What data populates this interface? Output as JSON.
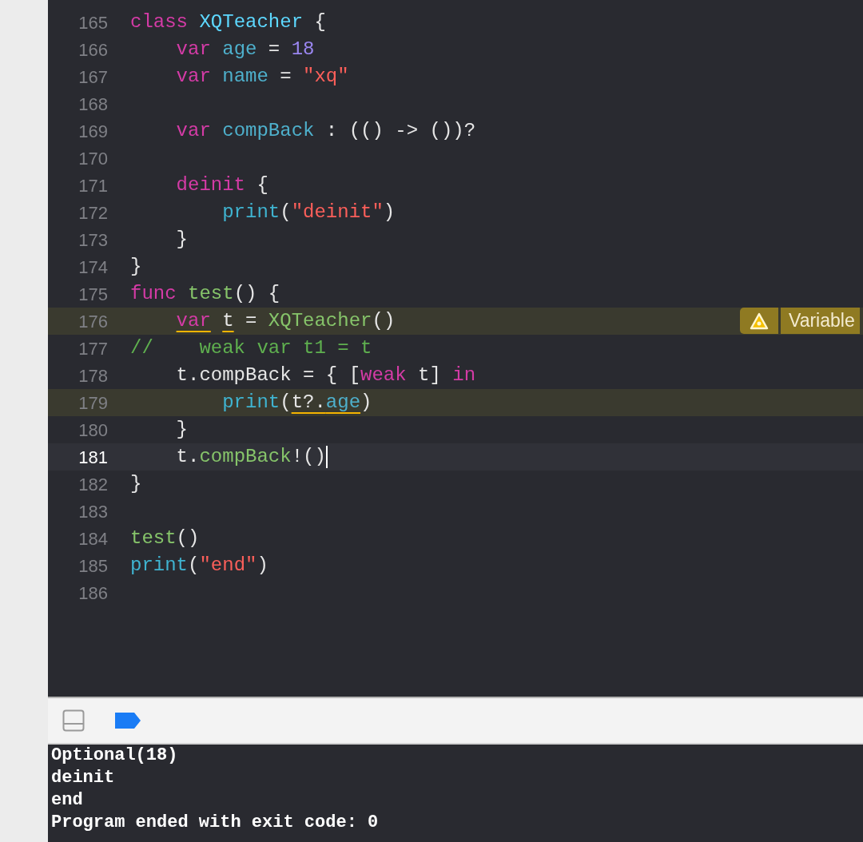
{
  "editor": {
    "lines": [
      {
        "number": "165",
        "tokens": [
          {
            "kind": "kw",
            "text": "class"
          },
          {
            "kind": "type",
            "text": " XQTeacher"
          },
          {
            "kind": "plain",
            "text": " {"
          }
        ]
      },
      {
        "number": "166",
        "tokens": [
          {
            "kind": "kw",
            "text": "    var"
          },
          {
            "kind": "prop",
            "text": " age"
          },
          {
            "kind": "plain",
            "text": " = "
          },
          {
            "kind": "num",
            "text": "18"
          }
        ]
      },
      {
        "number": "167",
        "tokens": [
          {
            "kind": "kw",
            "text": "    var"
          },
          {
            "kind": "prop",
            "text": " name"
          },
          {
            "kind": "plain",
            "text": " = "
          },
          {
            "kind": "str",
            "text": "\"xq\""
          }
        ]
      },
      {
        "number": "168"
      },
      {
        "number": "169",
        "tokens": [
          {
            "kind": "kw",
            "text": "    var"
          },
          {
            "kind": "prop",
            "text": " compBack"
          },
          {
            "kind": "plain",
            "text": " : (() -> ())?"
          }
        ]
      },
      {
        "number": "170"
      },
      {
        "number": "171",
        "tokens": [
          {
            "kind": "kw",
            "text": "    deinit"
          },
          {
            "kind": "plain",
            "text": " {"
          }
        ]
      },
      {
        "number": "172",
        "tokens": [
          {
            "kind": "fn",
            "text": "        print"
          },
          {
            "kind": "plain",
            "text": "("
          },
          {
            "kind": "str",
            "text": "\"deinit\""
          },
          {
            "kind": "plain",
            "text": ")"
          }
        ]
      },
      {
        "number": "173",
        "tokens": [
          {
            "kind": "plain",
            "text": "    }"
          }
        ]
      },
      {
        "number": "174",
        "tokens": [
          {
            "kind": "plain",
            "text": "}"
          }
        ]
      },
      {
        "number": "175",
        "tokens": [
          {
            "kind": "kw",
            "text": "func"
          },
          {
            "kind": "call",
            "text": " test"
          },
          {
            "kind": "plain",
            "text": "() {"
          }
        ]
      },
      {
        "number": "176",
        "warning": true,
        "badge": {
          "text": "Variable"
        },
        "tokens": [
          {
            "kind": "kw",
            "text": "    var",
            "warn": true
          },
          {
            "kind": "plain",
            "text": " t",
            "warn": true
          },
          {
            "kind": "plain",
            "text": " = "
          },
          {
            "kind": "call",
            "text": "XQTeacher"
          },
          {
            "kind": "plain",
            "text": "()"
          }
        ]
      },
      {
        "number": "177",
        "tokens": [
          {
            "kind": "comment",
            "text": "//    weak var t1 = t"
          }
        ]
      },
      {
        "number": "178",
        "tokens": [
          {
            "kind": "plain",
            "text": "    t.compBack = { ["
          },
          {
            "kind": "kw",
            "text": "weak"
          },
          {
            "kind": "plain",
            "text": " t] "
          },
          {
            "kind": "kw",
            "text": "in"
          }
        ]
      },
      {
        "number": "179",
        "warning": true,
        "tokens": [
          {
            "kind": "fn",
            "text": "        print"
          },
          {
            "kind": "plain",
            "text": "("
          },
          {
            "kind": "plain",
            "text": "t?.",
            "warn": true
          },
          {
            "kind": "prop",
            "text": "age",
            "warn": true
          },
          {
            "kind": "plain",
            "text": ")"
          }
        ]
      },
      {
        "number": "180",
        "tokens": [
          {
            "kind": "plain",
            "text": "    }"
          }
        ]
      },
      {
        "number": "181",
        "current": true,
        "tokens": [
          {
            "kind": "plain",
            "text": "    t."
          },
          {
            "kind": "call",
            "text": "compBack"
          },
          {
            "kind": "plain",
            "text": "!()"
          }
        ]
      },
      {
        "number": "182",
        "tokens": [
          {
            "kind": "plain",
            "text": "}"
          }
        ]
      },
      {
        "number": "183"
      },
      {
        "number": "184",
        "tokens": [
          {
            "kind": "call",
            "text": "test"
          },
          {
            "kind": "plain",
            "text": "()"
          }
        ]
      },
      {
        "number": "185",
        "tokens": [
          {
            "kind": "fn",
            "text": "print"
          },
          {
            "kind": "plain",
            "text": "("
          },
          {
            "kind": "str",
            "text": "\"end\""
          },
          {
            "kind": "plain",
            "text": ")"
          }
        ]
      },
      {
        "number": "186"
      }
    ]
  },
  "console": {
    "lines": [
      "Optional(18)",
      "deinit",
      "end",
      "Program ended with exit code: 0"
    ]
  }
}
